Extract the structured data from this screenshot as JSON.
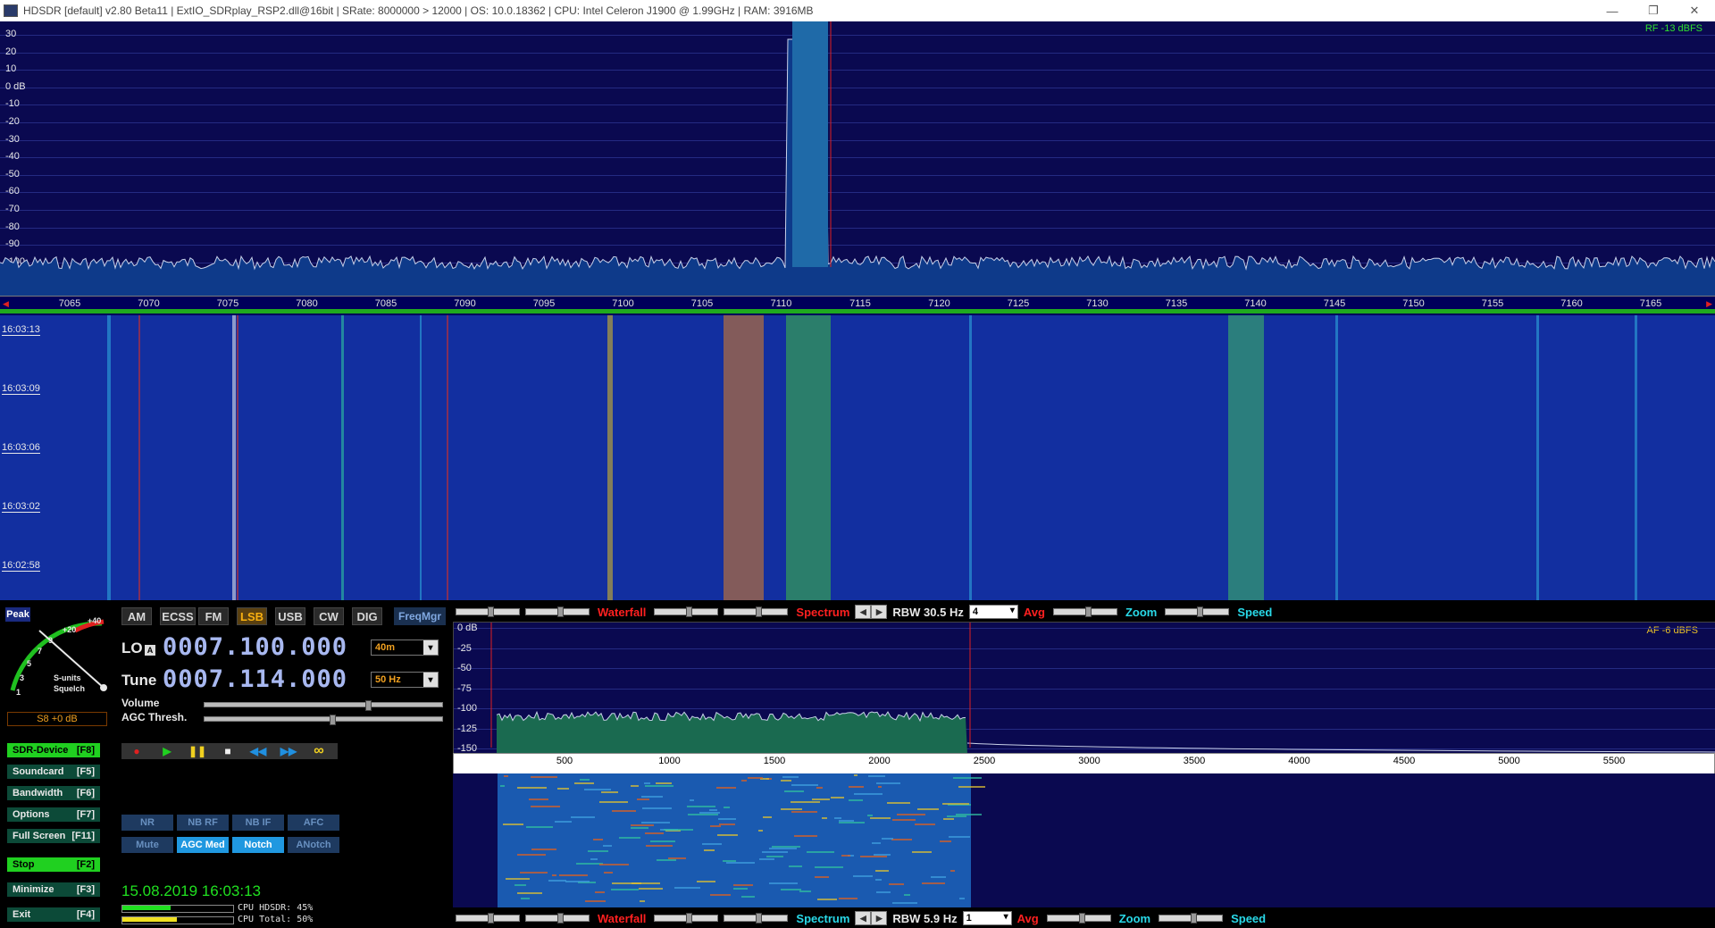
{
  "window": {
    "title": "HDSDR  [default]  v2.80 Beta11  |  ExtIO_SDRplay_RSP2.dll@16bit  |  SRate: 8000000 > 12000  |  OS: 10.0.18362  |  CPU: Intel Celeron  J1900  @ 1.99GHz  |  RAM: 3916MB",
    "minimize": "—",
    "restore": "❐",
    "close": "✕"
  },
  "rf_spectrum": {
    "level_readout": "RF -13 dBFS",
    "db_labels": [
      "30",
      "20",
      "10",
      "0 dB",
      "-10",
      "-20",
      "-30",
      "-40",
      "-50",
      "-60",
      "-70",
      "-80",
      "-90",
      "-100",
      "-110"
    ],
    "freq_labels": [
      "7065",
      "7070",
      "7075",
      "7080",
      "7085",
      "7090",
      "7095",
      "7100",
      "7105",
      "7110",
      "7115",
      "7120",
      "7125",
      "7130",
      "7135",
      "7140",
      "7145",
      "7150",
      "7155",
      "7160",
      "7165"
    ]
  },
  "rf_waterfall": {
    "timestamps": [
      "16:03:13",
      "16:03:09",
      "16:03:06",
      "16:03:02",
      "16:02:58"
    ]
  },
  "rf_controls": {
    "waterfall_label": "Waterfall",
    "spectrum_label": "Spectrum",
    "rbw_label": "RBW 30.5 Hz",
    "avg_value": "4",
    "avg_label": "Avg",
    "zoom_label": "Zoom",
    "speed_label": "Speed"
  },
  "af_spectrum": {
    "level_readout": "AF  -6 dBFS",
    "db_labels": [
      "0 dB",
      "-25",
      "-50",
      "-75",
      "-100",
      "-125",
      "-150"
    ],
    "freq_labels": [
      "500",
      "1000",
      "1500",
      "2000",
      "2500",
      "3000",
      "3500",
      "4000",
      "4500",
      "5000",
      "5500"
    ]
  },
  "af_controls": {
    "waterfall_label": "Waterfall",
    "spectrum_label": "Spectrum",
    "rbw_label": "RBW  5.9 Hz",
    "avg_value": "1",
    "avg_label": "Avg",
    "zoom_label": "Zoom",
    "speed_label": "Speed"
  },
  "smeter": {
    "peak_label": "Peak",
    "scale": [
      "1",
      "3",
      "5",
      "7",
      "9",
      "+20",
      "+40"
    ],
    "caption1": "S-units",
    "caption2": "Squelch",
    "reading": "S8 +0 dB"
  },
  "modes": [
    {
      "label": "AM"
    },
    {
      "label": "ECSS"
    },
    {
      "label": "FM"
    },
    {
      "label": "LSB"
    },
    {
      "label": "USB"
    },
    {
      "label": "CW"
    },
    {
      "label": "DIG"
    }
  ],
  "freqmgr_label": "FreqMgr",
  "lo": {
    "label": "LO",
    "badge": "A",
    "freq": "0007.100.000",
    "band": "40m"
  },
  "tune": {
    "label": "Tune",
    "freq": "0007.114.000",
    "step": "50 Hz"
  },
  "volume_label": "Volume",
  "agc_thresh_label": "AGC Thresh.",
  "side_buttons": [
    {
      "label": "SDR-Device",
      "key": "[F8]"
    },
    {
      "label": "Soundcard",
      "key": "[F5]"
    },
    {
      "label": "Bandwidth",
      "key": "[F6]"
    },
    {
      "label": "Options",
      "key": "[F7]"
    },
    {
      "label": "Full Screen",
      "key": "[F11]"
    },
    {
      "label": "Stop",
      "key": "[F2]"
    },
    {
      "label": "Minimize",
      "key": "[F3]"
    },
    {
      "label": "Exit",
      "key": "[F4]"
    }
  ],
  "transport": {
    "record": "●",
    "play": "▶",
    "pause": "❚❚",
    "stop": "■",
    "rewind": "◀◀",
    "forward": "▶▶",
    "loop": "∞"
  },
  "dsp_buttons_row1": [
    "NR",
    "NB RF",
    "NB IF",
    "AFC"
  ],
  "dsp_buttons_row2": [
    "Mute",
    "AGC Med",
    "Notch",
    "ANotch"
  ],
  "datetime": "15.08.2019 16:03:13",
  "cpu": {
    "hdsdr": "CPU HDSDR: 45%",
    "total": "CPU Total: 50%"
  }
}
